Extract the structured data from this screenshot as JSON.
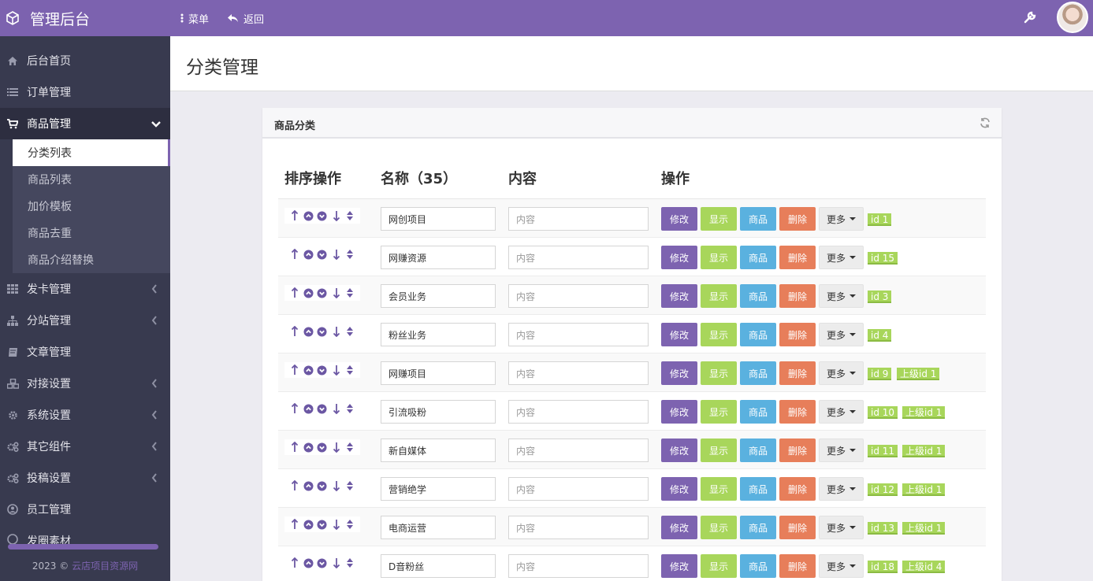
{
  "app": {
    "title": "管理后台"
  },
  "topbar": {
    "menu_label": "菜单",
    "back_label": "返回"
  },
  "sidebar": {
    "items": [
      {
        "label": "后台首页",
        "icon": "home-icon"
      },
      {
        "label": "订单管理",
        "icon": "list-icon"
      },
      {
        "label": "商品管理",
        "icon": "cart-icon",
        "expanded": true
      },
      {
        "label": "发卡管理",
        "icon": "grid-icon"
      },
      {
        "label": "分站管理",
        "icon": "sitemap-icon"
      },
      {
        "label": "文章管理",
        "icon": "book-icon"
      },
      {
        "label": "对接设置",
        "icon": "cubes-icon"
      },
      {
        "label": "系统设置",
        "icon": "gear-icon"
      },
      {
        "label": "其它组件",
        "icon": "gears-icon"
      },
      {
        "label": "投稿设置",
        "icon": "gears-icon"
      },
      {
        "label": "员工管理",
        "icon": "user-icon"
      },
      {
        "label": "发圈素材",
        "icon": "circle-icon"
      }
    ],
    "sub_items": [
      "分类列表",
      "商品列表",
      "加价模板",
      "商品去重",
      "商品介绍替换"
    ],
    "footer_year": "2023 ©",
    "footer_link": "云店项目资源网"
  },
  "page": {
    "title": "分类管理"
  },
  "panel": {
    "title": "商品分类",
    "headers": {
      "sort": "排序操作",
      "name": "名称（35）",
      "content": "内容",
      "ops": "操作"
    },
    "content_placeholder": "内容",
    "buttons": {
      "edit": "修改",
      "show": "显示",
      "goods": "商品",
      "delete": "删除",
      "more": "更多"
    },
    "rows": [
      {
        "name": "网创项目",
        "id": "id 1",
        "parent": ""
      },
      {
        "name": "网赚资源",
        "id": "id 15",
        "parent": ""
      },
      {
        "name": "会员业务",
        "id": "id 3",
        "parent": ""
      },
      {
        "name": "粉丝业务",
        "id": "id 4",
        "parent": ""
      },
      {
        "name": "网赚项目",
        "id": "id 9",
        "parent": "上级id 1"
      },
      {
        "name": "引流吸粉",
        "id": "id 10",
        "parent": "上级id 1"
      },
      {
        "name": "新自媒体",
        "id": "id 11",
        "parent": "上级id 1"
      },
      {
        "name": "营销绝学",
        "id": "id 12",
        "parent": "上级id 1"
      },
      {
        "name": "电商运营",
        "id": "id 13",
        "parent": "上级id 1"
      },
      {
        "name": "D音粉丝",
        "id": "id 18",
        "parent": "上级id 4"
      }
    ]
  }
}
